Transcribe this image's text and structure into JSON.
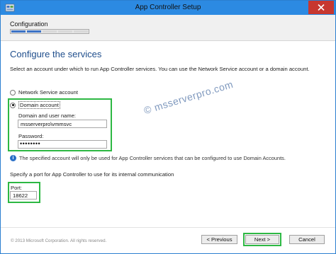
{
  "window": {
    "title": "App Controller Setup"
  },
  "progress": {
    "label": "Configuration",
    "segments_total": 5,
    "segments_done": 2
  },
  "page": {
    "heading": "Configure the services",
    "description": "Select an account under which to run App Controller services. You can use the Network Service account or a domain account."
  },
  "account": {
    "network_service_label": "Network Service account",
    "domain_account_label": "Domain account",
    "selected": "domain",
    "username_label": "Domain and user name:",
    "username_value": "msserverpro\\vmmsvc",
    "password_label": "Password:",
    "password_masked": "••••••••"
  },
  "info": {
    "text": "The specified account will only be used for App Controller services that can be configured to use Domain Accounts."
  },
  "port": {
    "description": "Specify a port for App Controller to use for its internal communication",
    "label": "Port:",
    "value": "18622"
  },
  "watermark": "© mssеrverpro.com",
  "footer": {
    "copyright": "© 2013 Microsoft Corporation. All rights reserved.",
    "previous_label": "< Previous",
    "next_label": "Next >",
    "cancel_label": "Cancel"
  },
  "colors": {
    "titlebar": "#2c8ae2",
    "highlight": "#2db843",
    "heading": "#1f4e8c",
    "close": "#c7372f"
  }
}
